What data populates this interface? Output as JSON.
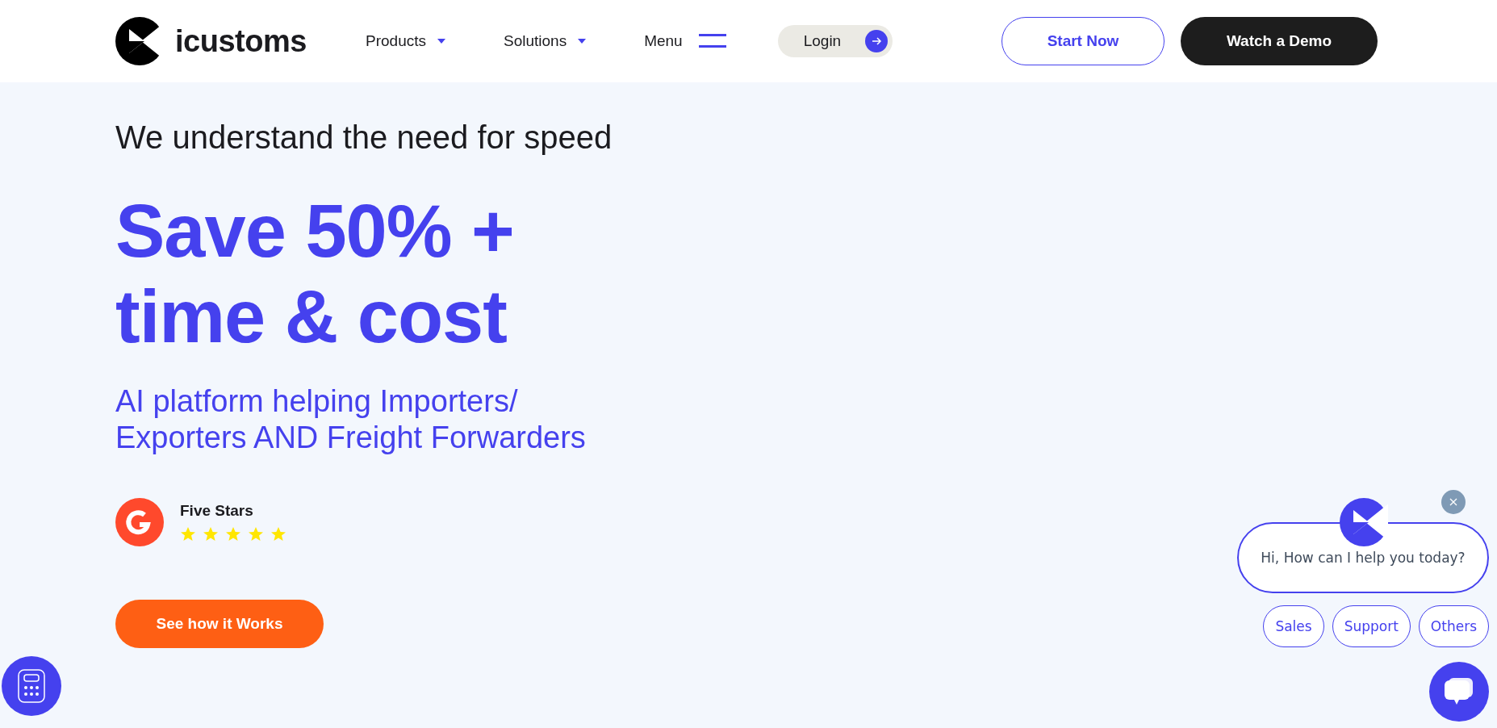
{
  "header": {
    "logo": "icustoms",
    "nav": [
      {
        "label": "Products",
        "kind": "dropdown"
      },
      {
        "label": "Solutions",
        "kind": "dropdown"
      },
      {
        "label": "Menu",
        "kind": "menu"
      }
    ],
    "login": "Login",
    "buttons": [
      {
        "label": "Start Now",
        "kind": "outline"
      },
      {
        "label": "Watch a Demo",
        "kind": "dark"
      }
    ]
  },
  "hero": {
    "eyebrow": "We understand the need for speed",
    "headline": [
      "Save 50% +",
      "time & cost"
    ],
    "subtitle": "AI platform helping Importers/ Exporters AND Freight Forwarders",
    "rating": {
      "label": "Five Stars",
      "stars": 5
    },
    "cta": "See how it Works"
  },
  "chat": {
    "greeting": "Hi, How can I help you today?",
    "options": [
      "Sales",
      "Support",
      "Others"
    ]
  }
}
